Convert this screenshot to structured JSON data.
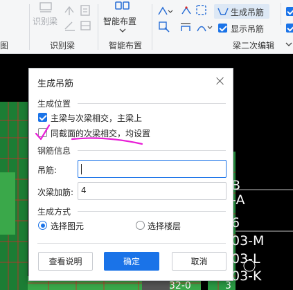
{
  "ribbon": {
    "groups": {
      "left_partial": "图",
      "identify_beam": "识别梁",
      "smart_layout": "智能布置",
      "secondary_beam_edit": "梁二次编辑"
    },
    "identify_beam_button": "识别梁",
    "smart_layout_button": "智能布置",
    "generate_hanger_button": "生成吊筋",
    "show_hanger_label": "显示吊筋",
    "show_hanger_checked": true
  },
  "cad": {
    "labels": [
      "B",
      "-A",
      "6",
      "03-M",
      "03-L",
      "03-K",
      "32-0",
      "3"
    ]
  },
  "dialog": {
    "title": "生成吊筋",
    "section_position": "生成位置",
    "option_main_secondary": "主梁与次梁相交，主梁上",
    "option_main_secondary_checked": true,
    "option_same_section": "同截面的次梁相交，均设置",
    "option_same_section_checked": false,
    "section_rebar": "钢筋信息",
    "hanger_label": "吊筋:",
    "hanger_value": "",
    "secondary_rebar_label": "次梁加筋:",
    "secondary_rebar_value": "4",
    "section_method": "生成方式",
    "radio_select_element": "选择图元",
    "radio_select_floor": "选择楼层",
    "selected_method": "选择图元",
    "btn_help": "查看说明",
    "btn_ok": "确定",
    "btn_cancel": "取消"
  },
  "colors": {
    "accent": "#1a73e8",
    "annotation": "#e81ed6",
    "cad_green": "#3aa84a",
    "cad_red": "#d62828"
  }
}
